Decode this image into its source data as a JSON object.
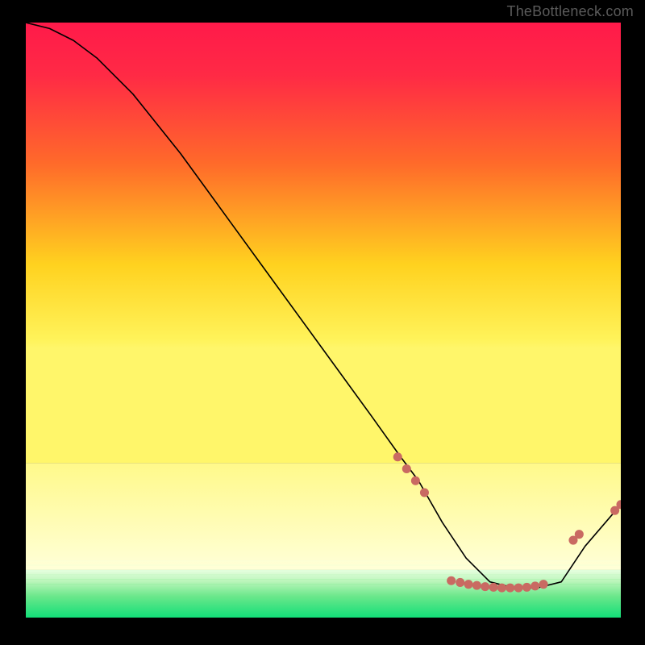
{
  "watermark": "TheBottleneck.com",
  "colors": {
    "bg_black": "#000000",
    "grad_top": "#ff1a4a",
    "grad_mid1": "#ff6a2a",
    "grad_mid2": "#ffd21f",
    "grad_low": "#fff35a",
    "pale_yellow": "#ffffb0",
    "green_light": "#c8f7c5",
    "green_mid": "#7de88e",
    "green_deep": "#18e07a",
    "line": "#000000",
    "dot": "#c96a62",
    "watermark": "#5a5a5a"
  },
  "chart_data": {
    "type": "line",
    "title": "",
    "xlabel": "",
    "ylabel": "",
    "xlim": [
      0,
      100
    ],
    "ylim": [
      0,
      100
    ],
    "series": [
      {
        "name": "curve",
        "x": [
          0,
          4,
          8,
          12,
          18,
          26,
          34,
          42,
          50,
          58,
          63,
          66,
          70,
          74,
          78,
          82,
          86,
          90,
          94,
          100
        ],
        "y": [
          100,
          99,
          97,
          94,
          88,
          78,
          67,
          56,
          45,
          34,
          27,
          23,
          16,
          10,
          6,
          5,
          5,
          6,
          12,
          19
        ]
      }
    ],
    "dots": [
      {
        "x": 62.5,
        "y": 27
      },
      {
        "x": 64.0,
        "y": 25
      },
      {
        "x": 65.5,
        "y": 23
      },
      {
        "x": 67.0,
        "y": 21
      },
      {
        "x": 71.5,
        "y": 6.2
      },
      {
        "x": 73.0,
        "y": 5.9
      },
      {
        "x": 74.4,
        "y": 5.6
      },
      {
        "x": 75.8,
        "y": 5.4
      },
      {
        "x": 77.2,
        "y": 5.2
      },
      {
        "x": 78.6,
        "y": 5.1
      },
      {
        "x": 80.0,
        "y": 5.0
      },
      {
        "x": 81.4,
        "y": 5.0
      },
      {
        "x": 82.8,
        "y": 5.0
      },
      {
        "x": 84.2,
        "y": 5.1
      },
      {
        "x": 85.6,
        "y": 5.3
      },
      {
        "x": 87.0,
        "y": 5.6
      },
      {
        "x": 92.0,
        "y": 13
      },
      {
        "x": 93.0,
        "y": 14
      },
      {
        "x": 99.0,
        "y": 18
      },
      {
        "x": 100.0,
        "y": 19
      }
    ],
    "background_bands": {
      "pale_yellow_start": 74,
      "green_start": 92
    }
  }
}
